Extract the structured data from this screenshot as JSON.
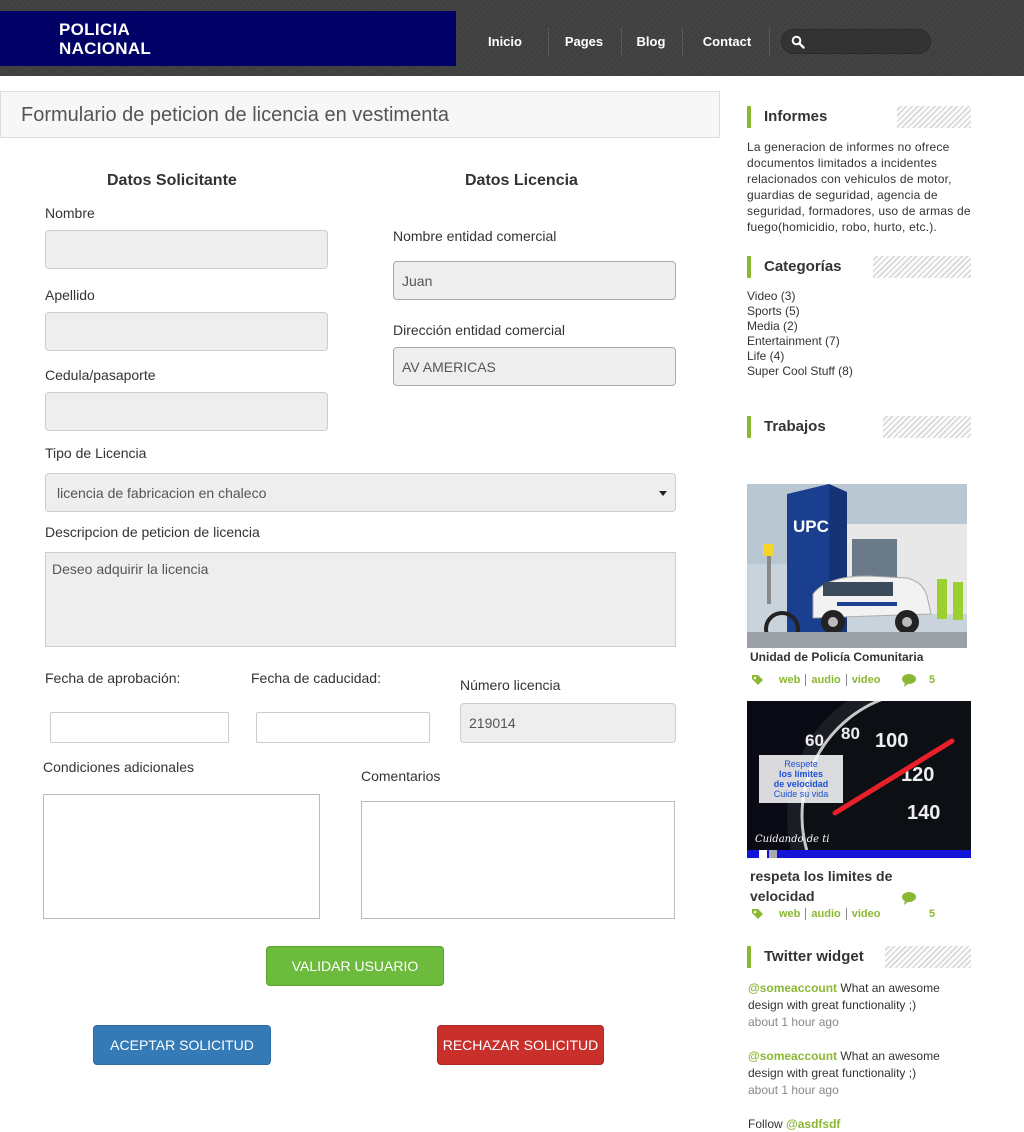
{
  "header": {
    "logo_line1": "POLICIA",
    "logo_line2": "NACIONAL",
    "nav": [
      "Inicio",
      "Pages",
      "Blog",
      "Contact"
    ],
    "search_placeholder": ""
  },
  "form": {
    "title": "Formulario de peticion de licencia en vestimenta",
    "section_applicant": "Datos Solicitante",
    "section_license": "Datos Licencia",
    "nombre_label": "Nombre",
    "nombre_value": "",
    "apellido_label": "Apellido",
    "apellido_value": "",
    "cedula_label": "Cedula/pasaporte",
    "cedula_value": "",
    "entidad_label": "Nombre entidad comercial",
    "entidad_value": "Juan",
    "direccion_label": "Dirección entidad comercial",
    "direccion_value": "AV AMERICAS",
    "tipo_label": "Tipo de Licencia",
    "tipo_value": "licencia de fabricacion en chaleco",
    "descripcion_label": "Descripcion de peticion de licencia",
    "descripcion_value": "Deseo adquirir la licencia",
    "fecha_aprobacion_label": "Fecha de aprobación:",
    "fecha_caducidad_label": "Fecha de caducidad:",
    "numero_label": "Número licencia",
    "numero_value": "219014",
    "condiciones_label": "Condiciones adicionales",
    "comentarios_label": "Comentarios",
    "validar_button": "VALIDAR USUARIO",
    "aceptar_button": "ACEPTAR SOLICITUD",
    "rechazar_button": "RECHAZAR SOLICITUD"
  },
  "sidebar": {
    "informes_title": "Informes",
    "informes_text": "La generacion de informes no ofrece documentos limitados a incidentes relacionados con vehiculos de motor, guardias de seguridad, agencia de seguridad, formadores, uso de armas de fuego(homicidio, robo, hurto, etc.).",
    "categorias_title": "Categorías",
    "categories": [
      "Video (3)",
      "Sports (5)",
      "Media (2)",
      "Entertainment (7)",
      "Life (4)",
      "Super Cool Stuff (8)"
    ],
    "trabajos_title": "Trabajos",
    "works": [
      {
        "title": "Unidad de Policía Comunitaria",
        "tags": [
          "web",
          "audio",
          "video"
        ],
        "comments": "5",
        "img_text": "UPC"
      },
      {
        "title": "respeta los limites de velocidad",
        "tags": [
          "web",
          "audio",
          "video"
        ],
        "comments": "5",
        "img_lines": [
          "Respete",
          "los límites",
          "de velocidad",
          "Cuide su vida"
        ],
        "img_caption": "Cuidando de ti"
      }
    ],
    "twitter_title": "Twitter widget",
    "tweets": [
      {
        "account": "@someaccount",
        "text": " What an awesome design with great functionality ;)",
        "time": "about 1 hour ago"
      },
      {
        "account": "@someaccount",
        "text": " What an awesome design with great functionality ;)",
        "time": "about 1 hour ago"
      }
    ],
    "follow_prefix": "Follow ",
    "follow_account": "@asdfsdf"
  },
  "colors": {
    "brand_navy": "#000066",
    "accent_green": "#8ab833",
    "button_green": "#6cbb3c",
    "button_blue": "#337ab7",
    "button_red": "#c9302c"
  }
}
